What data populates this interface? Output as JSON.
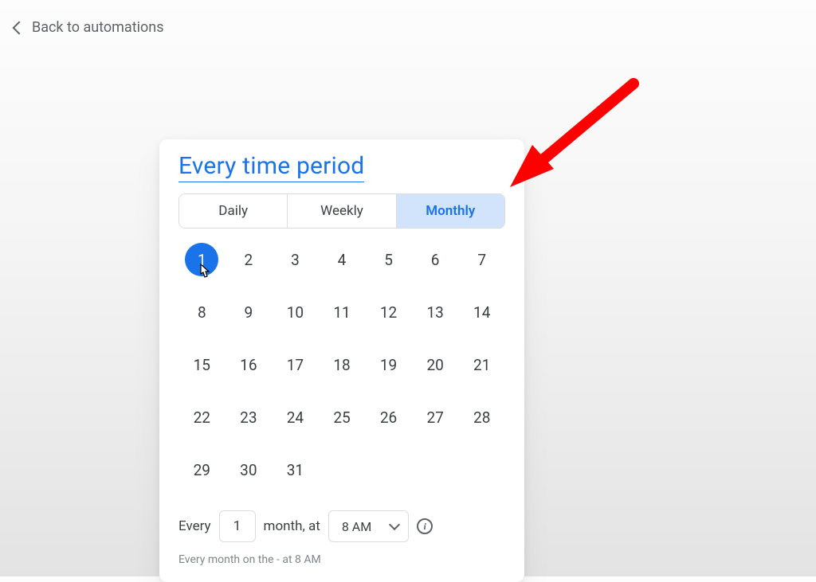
{
  "back_link": {
    "label": "Back to automations"
  },
  "title": "Every time period",
  "tabs": [
    {
      "id": "daily",
      "label": "Daily",
      "active": false
    },
    {
      "id": "weekly",
      "label": "Weekly",
      "active": false
    },
    {
      "id": "monthly",
      "label": "Monthly",
      "active": true
    }
  ],
  "selected_day": 1,
  "days": [
    1,
    2,
    3,
    4,
    5,
    6,
    7,
    8,
    9,
    10,
    11,
    12,
    13,
    14,
    15,
    16,
    17,
    18,
    19,
    20,
    21,
    22,
    23,
    24,
    25,
    26,
    27,
    28,
    29,
    30,
    31
  ],
  "frequency": {
    "prefix": "Every",
    "value": "1",
    "unit_label": "month, at",
    "time": "8 AM"
  },
  "summary_text": "Every month on the - at 8 AM",
  "annotation": {
    "arrow_color": "#ff0000"
  }
}
